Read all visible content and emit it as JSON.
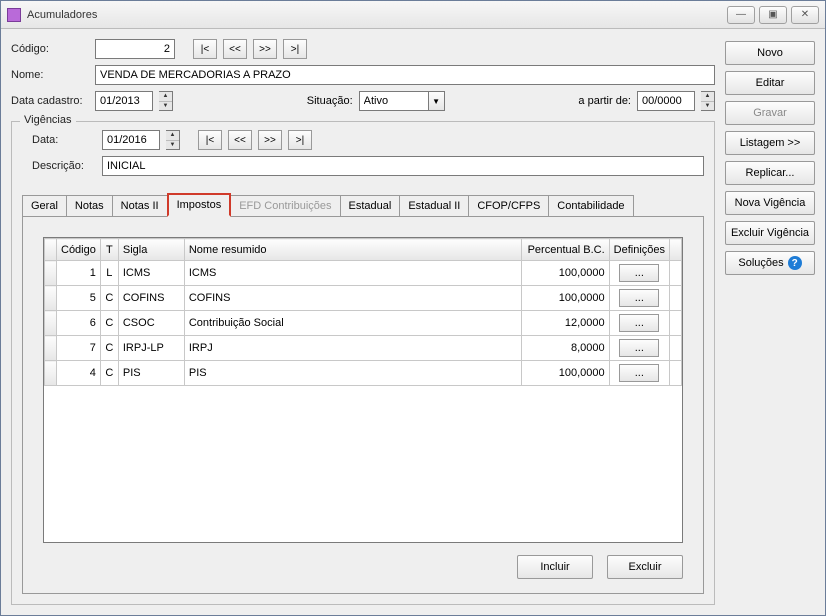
{
  "window": {
    "title": "Acumuladores"
  },
  "win_controls": {
    "min": "—",
    "max": "▣",
    "close": "✕"
  },
  "form": {
    "codigo_label": "Código:",
    "codigo_value": "2",
    "nome_label": "Nome:",
    "nome_value": "VENDA DE MERCADORIAS A PRAZO",
    "data_cadastro_label": "Data cadastro:",
    "data_cadastro_value": "01/2013",
    "situacao_label": "Situação:",
    "situacao_value": "Ativo",
    "a_partir_label": "a partir de:",
    "a_partir_value": "00/0000"
  },
  "nav": {
    "first": "|<",
    "prev": "<<",
    "next": ">>",
    "last": ">|"
  },
  "vigencias": {
    "legend": "Vigências",
    "data_label": "Data:",
    "data_value": "01/2016",
    "descricao_label": "Descrição:",
    "descricao_value": "INICIAL"
  },
  "tabs": [
    {
      "label": "Geral",
      "active": false,
      "disabled": false
    },
    {
      "label": "Notas",
      "active": false,
      "disabled": false
    },
    {
      "label": "Notas II",
      "active": false,
      "disabled": false
    },
    {
      "label": "Impostos",
      "active": true,
      "disabled": false
    },
    {
      "label": "EFD Contribuições",
      "active": false,
      "disabled": true
    },
    {
      "label": "Estadual",
      "active": false,
      "disabled": false
    },
    {
      "label": "Estadual II",
      "active": false,
      "disabled": false
    },
    {
      "label": "CFOP/CFPS",
      "active": false,
      "disabled": false
    },
    {
      "label": "Contabilidade",
      "active": false,
      "disabled": false
    }
  ],
  "table": {
    "headers": {
      "codigo": "Código",
      "t": "T",
      "sigla": "Sigla",
      "nome": "Nome resumido",
      "perc": "Percentual B.C.",
      "def": "Definições"
    },
    "rows": [
      {
        "codigo": "1",
        "t": "L",
        "sigla": "ICMS",
        "nome": "ICMS",
        "perc": "100,0000"
      },
      {
        "codigo": "5",
        "t": "C",
        "sigla": "COFINS",
        "nome": "COFINS",
        "perc": "100,0000"
      },
      {
        "codigo": "6",
        "t": "C",
        "sigla": "CSOC",
        "nome": "Contribuição Social",
        "perc": "12,0000"
      },
      {
        "codigo": "7",
        "t": "C",
        "sigla": "IRPJ-LP",
        "nome": "IRPJ",
        "perc": "8,0000"
      },
      {
        "codigo": "4",
        "t": "C",
        "sigla": "PIS",
        "nome": "PIS",
        "perc": "100,0000"
      }
    ],
    "def_btn": "..."
  },
  "panel_actions": {
    "incluir": "Incluir",
    "excluir": "Excluir"
  },
  "sidebar": {
    "novo": "Novo",
    "editar": "Editar",
    "gravar": "Gravar",
    "listagem": "Listagem >>",
    "replicar": "Replicar...",
    "nova_vigencia": "Nova Vigência",
    "excluir_vigencia": "Excluir Vigência",
    "solucoes": "Soluções"
  }
}
